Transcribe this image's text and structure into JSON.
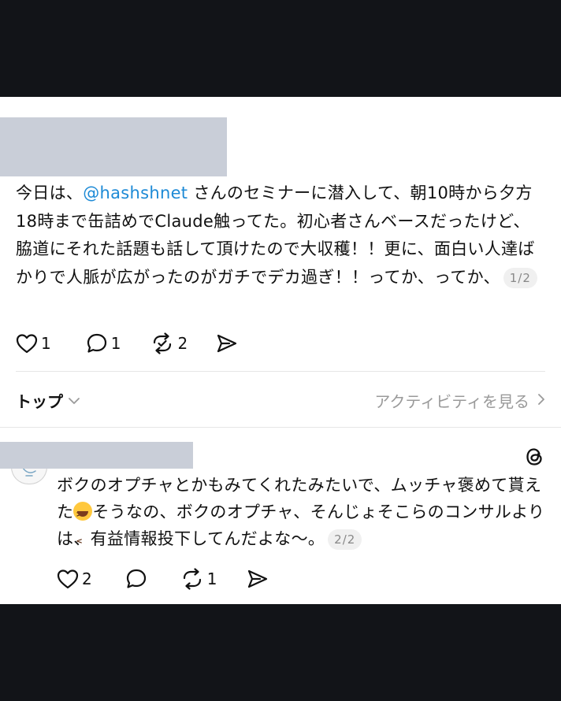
{
  "post": {
    "text_before_mention": "今日は、",
    "mention": "@hashshnet",
    "text_after_mention": " さんのセミナーに潜入して、朝10時から夕方18時まで缶詰めでClaude触ってた。初心者さんベースだったけど、脇道にそれた話題も話して頂けたので大収穫！！更に、面白い人達ばかりで人脈が広がったのがガチでデカ過ぎ！！ってか、ってか、",
    "page_indicator": "1/2",
    "likes": "1",
    "comments": "1",
    "reposts": "2"
  },
  "sort_bar": {
    "sort_label": "トップ",
    "activity_link": "アクティビティを見る"
  },
  "reply": {
    "text_part1": "ボクのオプチャとかもみてくれたみたいで、ムッチャ褒めて貰えた",
    "emoji": "laughing-face-emoji",
    "text_part2": "そうなの、ボクのオプチャ、そんじょそこらのコンサルよりは、有益情報投下してんだよな〜。",
    "page_indicator": "2/2",
    "likes": "2",
    "reposts": "1"
  },
  "colors": {
    "background": "#121418",
    "panel": "#ffffff",
    "mention": "#1d8ad6",
    "redaction": "#c9ced8",
    "muted": "#9a9a9a"
  }
}
